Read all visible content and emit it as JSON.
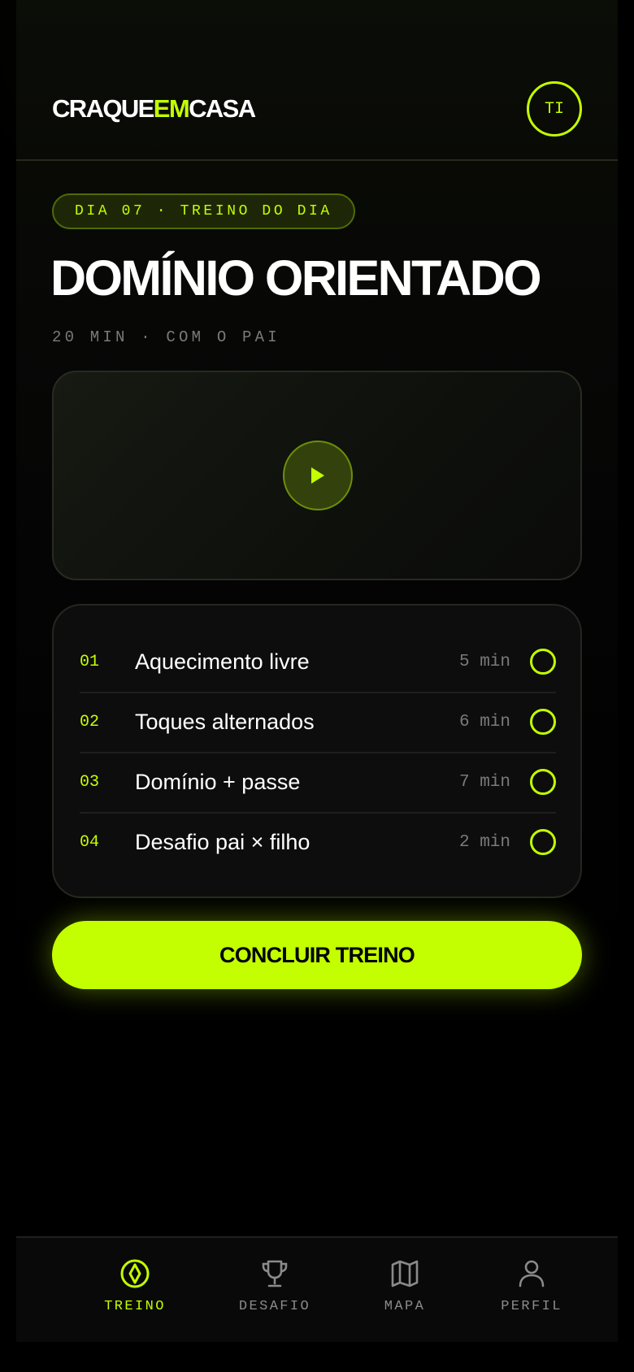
{
  "brand": {
    "logo_part1": "CRAQUE",
    "logo_part2": "EM",
    "logo_part3": "CASA",
    "accent_color": "#c3ff00",
    "background_color": "#000000"
  },
  "header": {
    "avatar_initials": "TI"
  },
  "session": {
    "badge": "DIA 07 · TREINO DO DIA",
    "title": "DOMÍNIO ORIENTADO",
    "meta": "20 MIN · COM O PAI",
    "video_icon": "play-icon"
  },
  "drills": [
    {
      "num": "01",
      "name": "Aquecimento livre",
      "time": "5 min",
      "done": false
    },
    {
      "num": "02",
      "name": "Toques alternados",
      "time": "6 min",
      "done": false
    },
    {
      "num": "03",
      "name": "Domínio + passe",
      "time": "7 min",
      "done": false
    },
    {
      "num": "04",
      "name": "Desafio pai × filho",
      "time": "2 min",
      "done": false
    }
  ],
  "cta": {
    "label": "CONCLUIR TREINO"
  },
  "nav": [
    {
      "label": "TREINO",
      "icon": "ball-diamond-icon",
      "active": true
    },
    {
      "label": "DESAFIO",
      "icon": "trophy-icon",
      "active": false
    },
    {
      "label": "MAPA",
      "icon": "map-icon",
      "active": false
    },
    {
      "label": "PERFIL",
      "icon": "user-icon",
      "active": false
    }
  ]
}
